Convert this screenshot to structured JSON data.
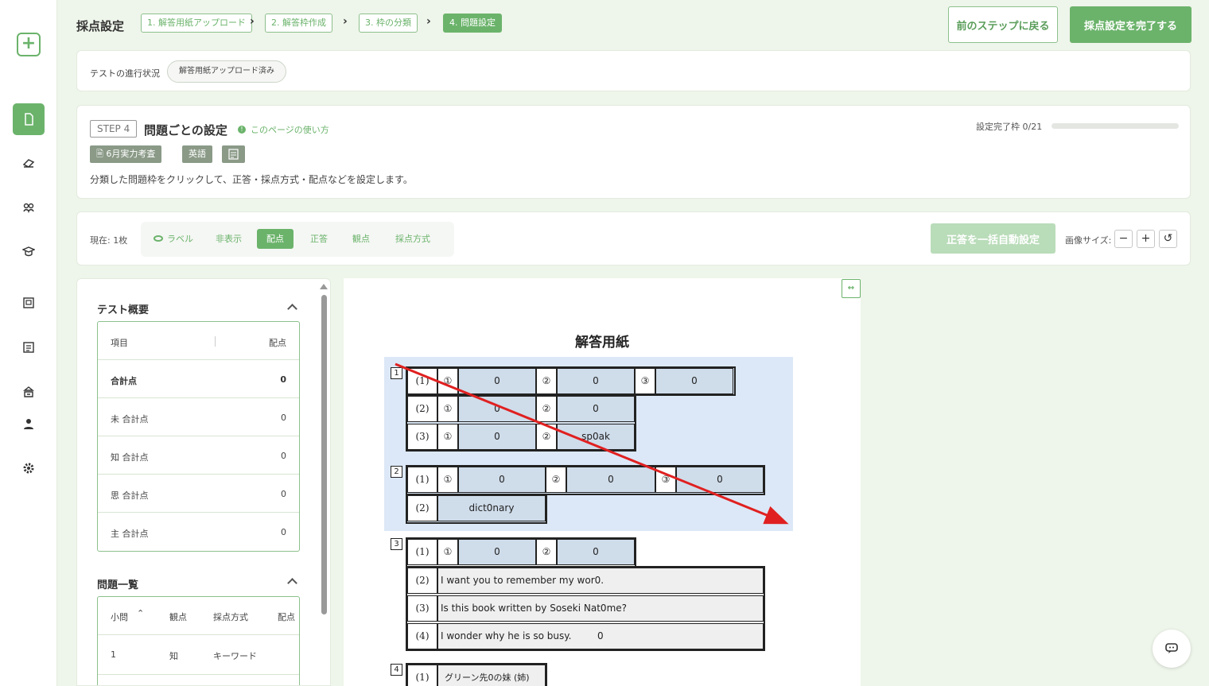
{
  "header": {
    "title": "採点設定",
    "breadcrumbs": [
      "1. 解答用紙アップロード",
      "2. 解答枠作成",
      "3. 枠の分類",
      "4. 問題設定"
    ],
    "back_label": "前のステップに戻る",
    "done_label": "採点設定を完了する"
  },
  "progress": {
    "label": "テストの進行状況",
    "status": "解答用紙アップロード済み"
  },
  "step": {
    "tag": "STEP 4",
    "title": "問題ごとの設定",
    "help": "このページの使い方",
    "tags": [
      "6月実力考査",
      "英語"
    ],
    "description": "分類した問題枠をクリックして、正答・採点方式・配点などを設定します。",
    "done_label": "設定完了枠 0/21",
    "done_fraction": 0
  },
  "toolbar": {
    "current": "現在: 1枚",
    "segments": [
      "ラベル",
      "非表示",
      "配点",
      "正答",
      "観点",
      "採点方式"
    ],
    "active_segment": "配点",
    "auto_label": "正答を一括自動設定",
    "size_label": "画像サイズ:",
    "size_minus": "−",
    "size_plus": "+",
    "size_reset": "↺"
  },
  "overview": {
    "title": "テスト概要",
    "header": {
      "item": "項目",
      "score": "配点"
    },
    "rows": [
      {
        "item": "合計点",
        "score": "0"
      },
      {
        "item": "未 合計点",
        "score": "0"
      },
      {
        "item": "知 合計点",
        "score": "0"
      },
      {
        "item": "思 合計点",
        "score": "0"
      },
      {
        "item": "主 合計点",
        "score": "0"
      }
    ]
  },
  "questions": {
    "title": "問題一覧",
    "header": {
      "q": "小問",
      "sort": "⌃",
      "view": "観点",
      "method": "採点方式",
      "score": "配点"
    },
    "rows": [
      {
        "q": "1",
        "view": "知",
        "method": "キーワード"
      }
    ]
  },
  "sheet": {
    "title": "解答用紙",
    "q1": {
      "num": "1",
      "r1": {
        "label": "(1)",
        "c1": "①",
        "a1": "0",
        "c2": "②",
        "a2": "0",
        "c3": "③",
        "a3": "0"
      },
      "r2": {
        "label": "(2)",
        "c1": "①",
        "a1": "0",
        "c2": "②",
        "a2": "0"
      },
      "r3": {
        "label": "(3)",
        "c1": "①",
        "a1": "0",
        "c2": "②",
        "a2": "sp0ak"
      }
    },
    "q2": {
      "num": "2",
      "r1": {
        "label": "(1)",
        "c1": "①",
        "a1": "0",
        "c2": "②",
        "a2": "0",
        "c3": "③",
        "a3": "0"
      },
      "r2": {
        "label": "(2)",
        "a1": "dict0nary"
      }
    },
    "q3": {
      "num": "3",
      "r1": {
        "label": "(1)",
        "c1": "①",
        "a1": "0",
        "c2": "②",
        "a2": "0"
      },
      "r2": {
        "label": "(2)",
        "text": "I want you to remember my wor0."
      },
      "r3": {
        "label": "(3)",
        "text": "Is this book written by Soseki Nat0me?"
      },
      "r4": {
        "label": "(4)",
        "text": "I wonder why he is so busy.",
        "ans": "0"
      }
    },
    "q4": {
      "num": "4",
      "r1": {
        "label": "(1)",
        "text": "グリーン先0の妹 (姉)"
      }
    }
  },
  "colors": {
    "accent": "#6bb36b",
    "arrow": "#e02020",
    "highlight": "#dce8f7"
  }
}
